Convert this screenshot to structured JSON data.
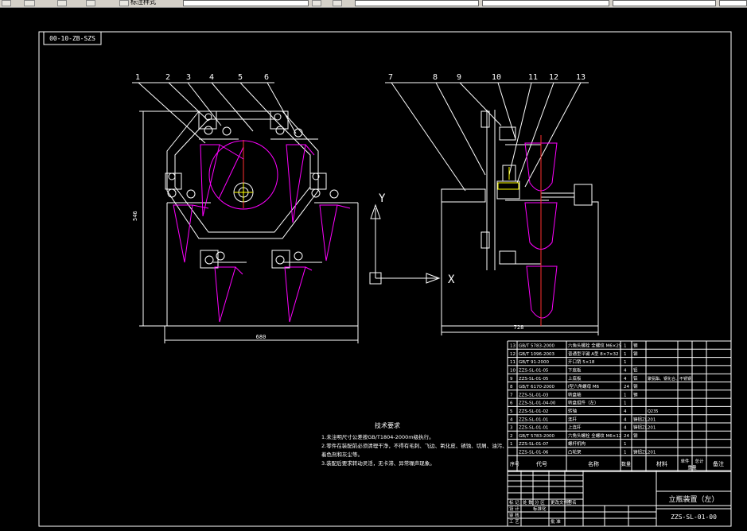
{
  "toolbar": {
    "fragment_text": "标注样式"
  },
  "drawing": {
    "stamp_code": "00-10-ZB-SZS",
    "front_view_labels": [
      "1",
      "2",
      "3",
      "4",
      "5",
      "6"
    ],
    "side_view_labels": [
      "7",
      "8",
      "9",
      "10",
      "11",
      "12",
      "13"
    ],
    "dim_height": "546",
    "dim_width_front": "680",
    "dim_width_side": "728",
    "ucs_y": "Y",
    "ucs_x": "X"
  },
  "tech_requirements": {
    "title": "技术要求",
    "lines": [
      "1.未注明尺寸公差按GB/T1804-2000m级执行。",
      "2.零件在装配前必须清理干净，不得有毛刺、飞边、氧化皮、锈蚀、切屑、油污、",
      "  着色剂和灰尘等。",
      "3.装配后要求转动灵活，无卡滞、异常噪声现象。"
    ]
  },
  "bom": {
    "rows": [
      {
        "no": "13",
        "code": "GB/T 5783-2000",
        "name": "六角头螺栓 全螺纹 M6×25",
        "qty": "1",
        "material": "钢",
        "note": ""
      },
      {
        "no": "12",
        "code": "GB/T 1096-2003",
        "name": "普通型平键 A型 8×7×32",
        "qty": "1",
        "material": "钢",
        "note": ""
      },
      {
        "no": "11",
        "code": "GB/T 91-2000",
        "name": "开口销 5×18",
        "qty": "1",
        "material": "",
        "note": ""
      },
      {
        "no": "10",
        "code": "ZZS-SL-01-05",
        "name": "下底板",
        "qty": "4",
        "material": "铝",
        "note": ""
      },
      {
        "no": "9",
        "code": "ZZS-SL-01-05",
        "name": "上底板",
        "qty": "4",
        "material": "铝",
        "note": "",
        "extra": "聚氨酯、钢化合、不锈钢"
      },
      {
        "no": "8",
        "code": "GB/T 6170-2000",
        "name": "I型六角螺母 M6",
        "qty": "24",
        "material": "钢",
        "note": ""
      },
      {
        "no": "7",
        "code": "ZZS-SL-01-03",
        "name": "转盘轴",
        "qty": "1",
        "material": "钢",
        "note": ""
      },
      {
        "no": "6",
        "code": "ZZS-SL-01-04-00",
        "name": "转盘组件（左）",
        "qty": "1",
        "material": "",
        "note": ""
      },
      {
        "no": "5",
        "code": "ZZS-SL-01-02",
        "name": "转轴",
        "qty": "4",
        "material": "",
        "note": "",
        "extra": "Q235"
      },
      {
        "no": "4",
        "code": "ZZS-SL-01-01",
        "name": "连杆",
        "qty": "4",
        "material": "铸铝ZL201",
        "note": ""
      },
      {
        "no": "3",
        "code": "ZZS-SL-01-01",
        "name": "上连杆",
        "qty": "4",
        "material": "铸铝ZL201",
        "note": ""
      },
      {
        "no": "2",
        "code": "GB/T 5783-2000",
        "name": "六角头螺栓 全螺纹 M6×12",
        "qty": "24",
        "material": "钢",
        "note": ""
      },
      {
        "no": "1",
        "code": "ZZS-SL-01-07",
        "name": "螺杆机构",
        "qty": "1",
        "material": "",
        "note": ""
      },
      {
        "no": "",
        "code": "ZZS-SL-01-06",
        "name": "凸轮架",
        "qty": "1",
        "material": "铸铝ZL201",
        "note": ""
      }
    ],
    "header": {
      "no": "序号",
      "code": "代号",
      "name": "名称",
      "qty": "数量",
      "material": "材料",
      "single": "单件",
      "total": "总计",
      "weight": "重量",
      "note": "备注"
    }
  },
  "title_block": {
    "title": "立瓶装置（左）",
    "drawing_no": "ZZS-SL-01-00",
    "small_rows": [
      "标 记",
      "处 数",
      "分 区",
      "更改文件号",
      "签 名",
      "年 月 日"
    ],
    "design": "设 计",
    "standard": "标准化",
    "review": "审 核",
    "process": "工 艺",
    "approve": "批 准"
  },
  "colors": {
    "line": "#ffffff",
    "part": "#ff00ff",
    "center": "#ff3030",
    "accent": "#ffff00",
    "background": "#000000"
  }
}
